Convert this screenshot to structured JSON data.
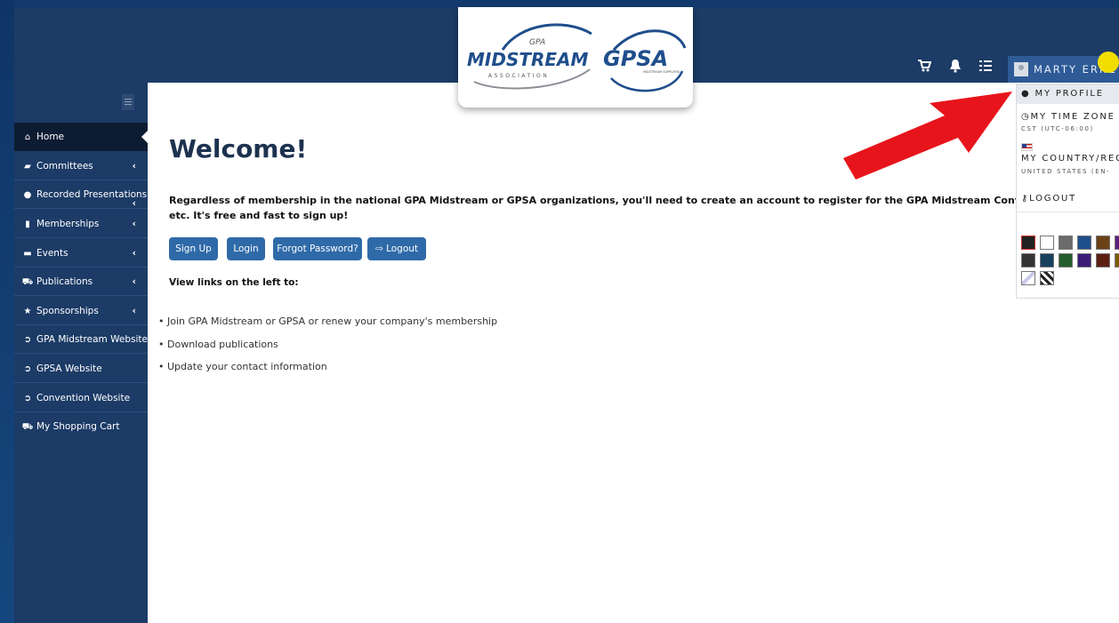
{
  "header": {
    "logo_primary_text": "MIDSTREAM",
    "logo_primary_badge": "GPA",
    "logo_primary_sub": "ASSOCIATION",
    "logo_secondary_text": "GPSA",
    "logo_secondary_sub": "MIDSTREAM SUPPLIERS",
    "icons": [
      "cart-icon",
      "bell-icon",
      "list-icon"
    ],
    "user_name": "MARTY ERNE"
  },
  "sidebar": {
    "items": [
      {
        "label": "Home",
        "icon": "home-icon",
        "chevron": ""
      },
      {
        "label": "Committees",
        "icon": "briefcase-icon",
        "chevron": "‹"
      },
      {
        "label": "Recorded Presentations",
        "icon": "play-circle-icon",
        "chevron": "‹"
      },
      {
        "label": "Memberships",
        "icon": "bookmark-icon",
        "chevron": "‹"
      },
      {
        "label": "Events",
        "icon": "ticket-icon",
        "chevron": "‹"
      },
      {
        "label": "Publications",
        "icon": "cart-icon",
        "chevron": "‹"
      },
      {
        "label": "Sponsorships",
        "icon": "star-icon",
        "chevron": "‹"
      },
      {
        "label": "GPA Midstream Website",
        "icon": "chevron-circle-icon",
        "chevron": ""
      },
      {
        "label": "GPSA Website",
        "icon": "chevron-circle-icon",
        "chevron": ""
      },
      {
        "label": "Convention Website",
        "icon": "chevron-circle-icon",
        "chevron": ""
      },
      {
        "label": "My Shopping Cart",
        "icon": "cart-icon",
        "chevron": ""
      }
    ]
  },
  "main": {
    "title": "Welcome!",
    "intro_line1": "Regardless of membership in the national GPA Midstream or GPSA organizations, you'll need to create an account to register for the GPA Midstream Convention, downl",
    "intro_line2": "etc. It's free and fast to sign up!",
    "buttons": {
      "signup": "Sign Up",
      "login": "Login",
      "forgot": "Forgot Password?",
      "logout": "Logout"
    },
    "view_links": "View links on the left to:",
    "bullets": [
      "Join GPA Midstream or GPSA or renew your company's membership",
      "Download publications",
      "Update your contact information"
    ]
  },
  "dropdown": {
    "my_profile": "MY PROFILE",
    "my_time_zone": "MY TIME ZONE",
    "time_zone_value": "CST (UTC-06:00)",
    "my_country": "MY COUNTRY/REG",
    "country_value": "UNITED STATES (EN-",
    "logout": "LOGOUT",
    "theme_colors": [
      "#222222",
      "#ffffff",
      "#6b6b6b",
      "#1f4e8c",
      "#6b4216",
      "#5a1f7a",
      "#333333",
      "#17415e",
      "#245c2e",
      "#3b1b78",
      "#5b1f12",
      "#7a5a00"
    ]
  },
  "annotation": {
    "arrow_color": "#e8141b",
    "highlight_color": "#f2dd00"
  }
}
